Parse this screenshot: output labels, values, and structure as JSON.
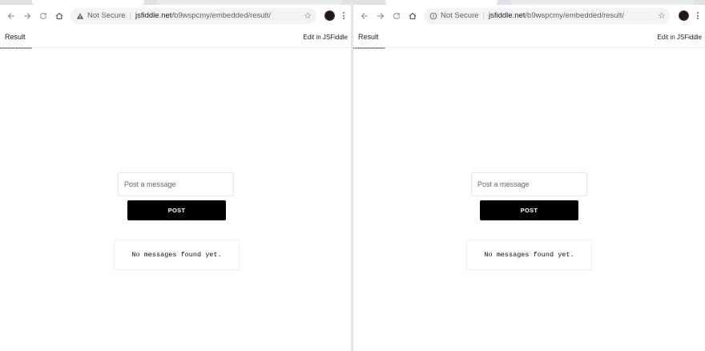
{
  "windows": [
    {
      "security_label": "Not Secure",
      "security_icon": "warning-icon",
      "url_host": "jsfiddle.net",
      "url_path": "/b9wspcmy/embedded/result/",
      "embed_tab": "Result",
      "edit_link": "Edit in JSFiddle",
      "input_placeholder": "Post a message",
      "post_label": "POST",
      "empty_message": "No messages found yet."
    },
    {
      "security_label": "Not Secure",
      "security_icon": "info-icon",
      "url_host": "jsfiddle.net",
      "url_path": "/b9wspcmy/embedded/result/",
      "embed_tab": "Result",
      "edit_link": "Edit in JSFiddle",
      "input_placeholder": "Post a message",
      "post_label": "POST",
      "empty_message": "No messages found yet."
    }
  ],
  "colors": {
    "accent_button": "#000000",
    "omnibox_bg": "#f1f3f4",
    "tabstrip_bg": "#dee1e6"
  }
}
